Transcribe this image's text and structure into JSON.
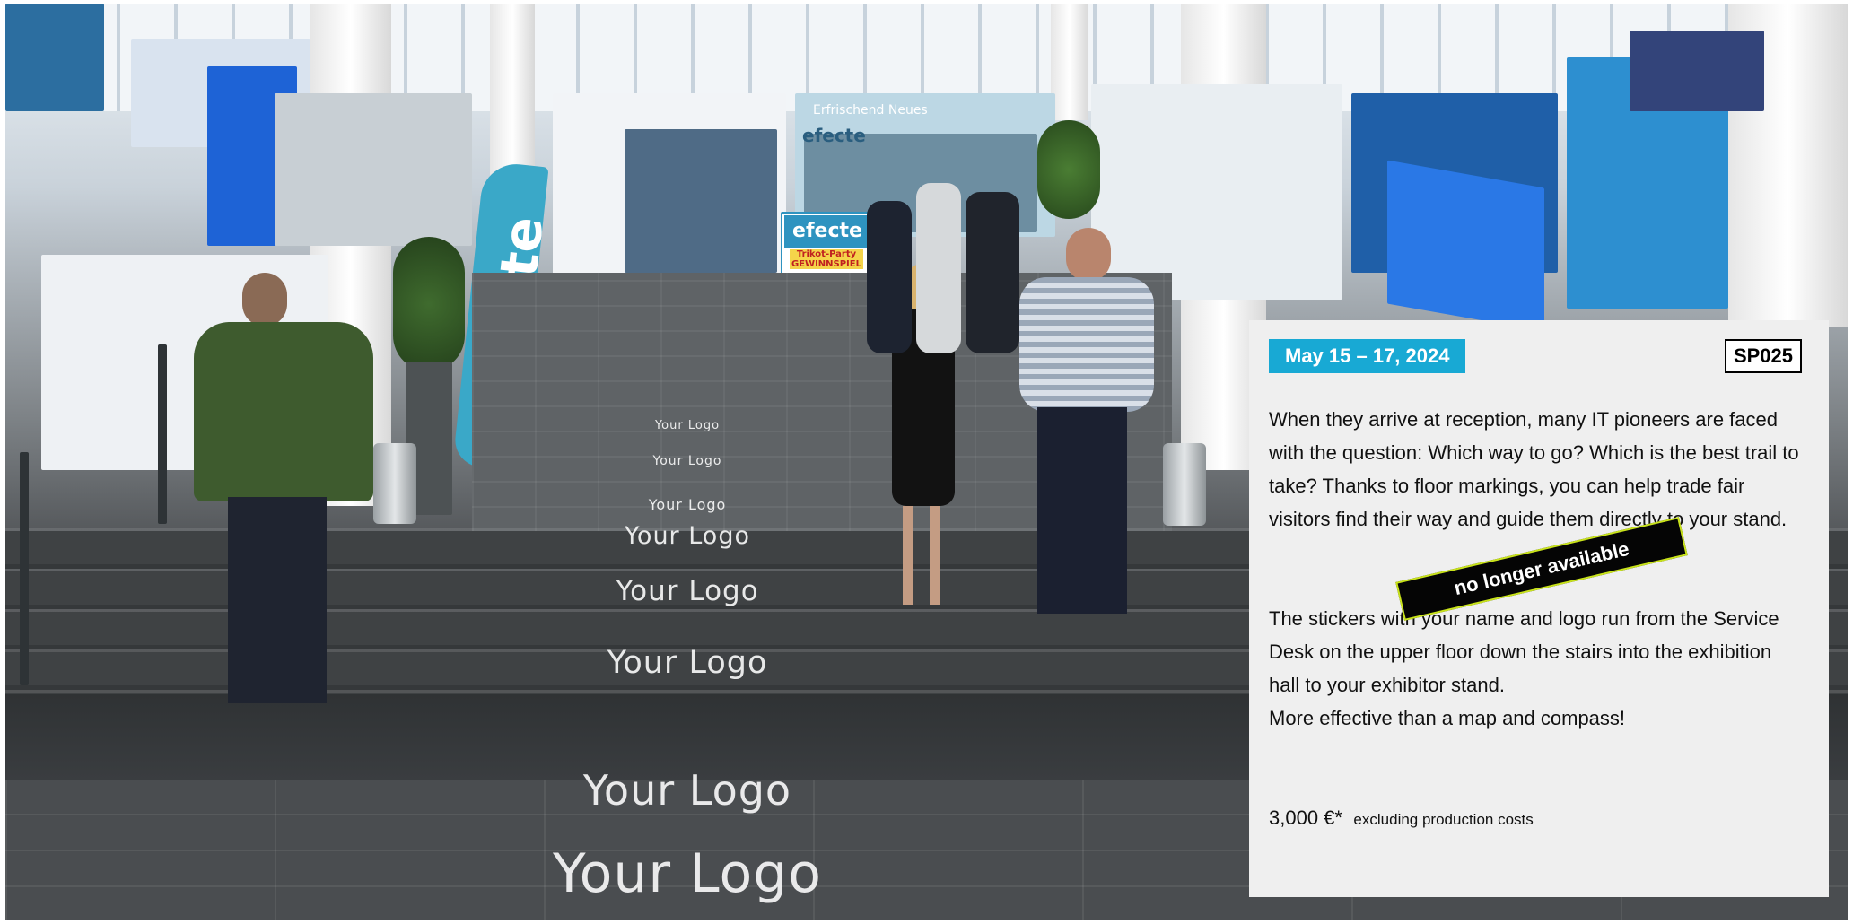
{
  "scene": {
    "banner_text": "efecte",
    "booth_signs": [
      "efecte",
      "efecte",
      "Erfrischend Neues",
      "Trikot-Party GEWINNSPIEL",
      "Your Logo"
    ],
    "floor_logos": [
      "Your Logo",
      "Your Logo",
      "Your Logo",
      "Your Logo",
      "Your Logo",
      "Your Logo",
      "Your Logo",
      "Your Logo"
    ]
  },
  "card": {
    "date": "May 15 – 17, 2024",
    "code": "SP025",
    "paragraph_1": "When they arrive at reception, many IT pioneers are faced with the question: Which way to go? Which is the best trail to take? Thanks to floor markings, you can help trade fair visitors find their way and guide them directly to your stand.",
    "paragraph_2": "The stickers with your name and logo run from the Service Desk on the upper floor down the stairs into the exhibition hall to your exhibitor stand.",
    "paragraph_3": "More effective than a map and compass!",
    "price": "3,000 €*",
    "price_note": "excluding production costs",
    "status_stamp": "no longer available"
  },
  "colors": {
    "accent": "#18a9d4",
    "card_background": "#efefef",
    "stamp_background": "#050505",
    "stamp_border": "#c9e31b",
    "banner": "#3aa8c8"
  }
}
